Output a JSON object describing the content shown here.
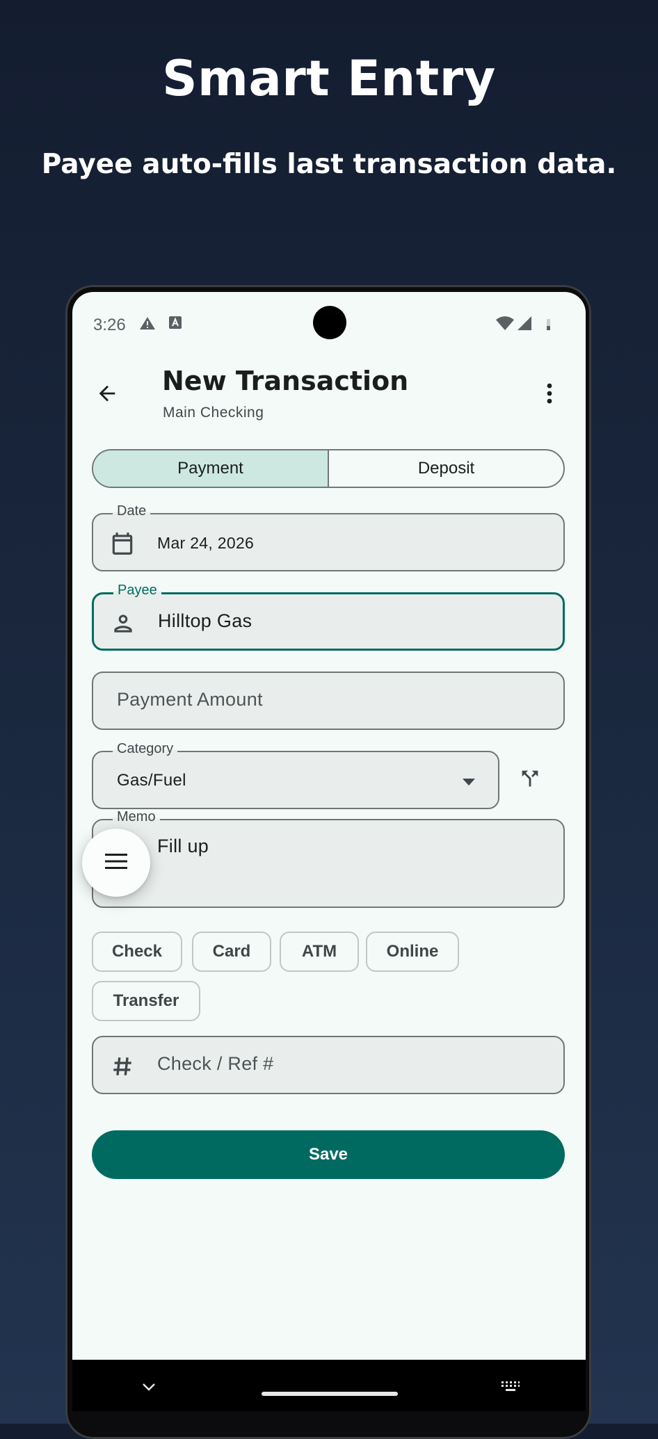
{
  "promo": {
    "title": "Smart Entry",
    "subtitle": "Payee auto-fills last transaction data."
  },
  "status_bar": {
    "time": "3:26",
    "icons": [
      "alert-icon",
      "a-badge-icon",
      "wifi-icon",
      "signal-icon",
      "battery-icon"
    ]
  },
  "app_bar": {
    "title": "New Transaction",
    "subtitle": "Main Checking"
  },
  "type_toggle": {
    "options": [
      "Payment",
      "Deposit"
    ],
    "selected": "Payment"
  },
  "form": {
    "date": {
      "label": "Date",
      "value": "Mar 24, 2026"
    },
    "payee": {
      "label": "Payee",
      "value": "Hilltop Gas"
    },
    "amount": {
      "placeholder": "Payment Amount"
    },
    "category": {
      "label": "Category",
      "value": "Gas/Fuel"
    },
    "memo": {
      "label": "Memo",
      "value": "Fill up"
    },
    "ref": {
      "placeholder": "Check / Ref #"
    }
  },
  "method_chips": [
    "Check",
    "Card",
    "ATM",
    "Online",
    "Transfer"
  ],
  "save_label": "Save",
  "colors": {
    "accent": "#006a61",
    "selected_segment": "#cce8e1",
    "background": "#f3faf7"
  }
}
